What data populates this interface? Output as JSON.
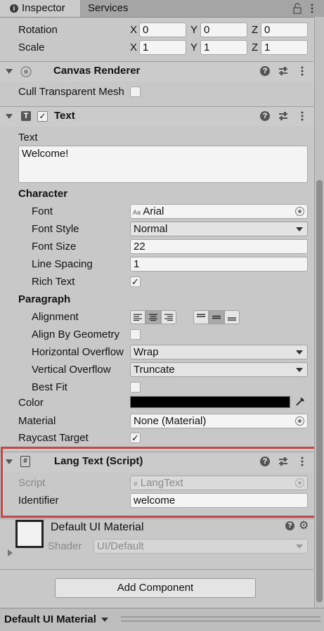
{
  "tabs": {
    "inspector": "Inspector",
    "services": "Services"
  },
  "transform": {
    "rotation_label": "Rotation",
    "scale_label": "Scale",
    "axis_x": "X",
    "axis_y": "Y",
    "axis_z": "Z",
    "rotation": {
      "x": "0",
      "y": "0",
      "z": "0"
    },
    "scale": {
      "x": "1",
      "y": "1",
      "z": "1"
    }
  },
  "canvas_renderer": {
    "title": "Canvas Renderer",
    "cull_label": "Cull Transparent Mesh",
    "cull_checked": false
  },
  "text_component": {
    "title": "Text",
    "text_label": "Text",
    "text_value": "Welcome!",
    "character_header": "Character",
    "font_label": "Font",
    "font_value": "Arial",
    "font_style_label": "Font Style",
    "font_style_value": "Normal",
    "font_size_label": "Font Size",
    "font_size_value": "22",
    "line_spacing_label": "Line Spacing",
    "line_spacing_value": "1",
    "rich_text_label": "Rich Text",
    "paragraph_header": "Paragraph",
    "alignment_label": "Alignment",
    "align_geometry_label": "Align By Geometry",
    "horizontal_overflow_label": "Horizontal Overflow",
    "horizontal_overflow_value": "Wrap",
    "vertical_overflow_label": "Vertical Overflow",
    "vertical_overflow_value": "Truncate",
    "best_fit_label": "Best Fit",
    "color_label": "Color",
    "color_value": "#000000",
    "material_label": "Material",
    "material_value": "None (Material)",
    "raycast_label": "Raycast Target"
  },
  "lang_text": {
    "title": "Lang Text (Script)",
    "script_label": "Script",
    "script_value": "LangText",
    "identifier_label": "Identifier",
    "identifier_value": "welcome",
    "highlight_color": "#e53935"
  },
  "material_section": {
    "name": "Default UI Material",
    "shader_label": "Shader",
    "shader_value": "UI/Default"
  },
  "add_component_label": "Add Component",
  "footer": {
    "label": "Default UI Material"
  },
  "icons": [
    "info-icon",
    "lock-icon",
    "menu-dots-icon",
    "help-icon",
    "preset-icon",
    "eyedropper-icon",
    "object-picker-icon"
  ]
}
